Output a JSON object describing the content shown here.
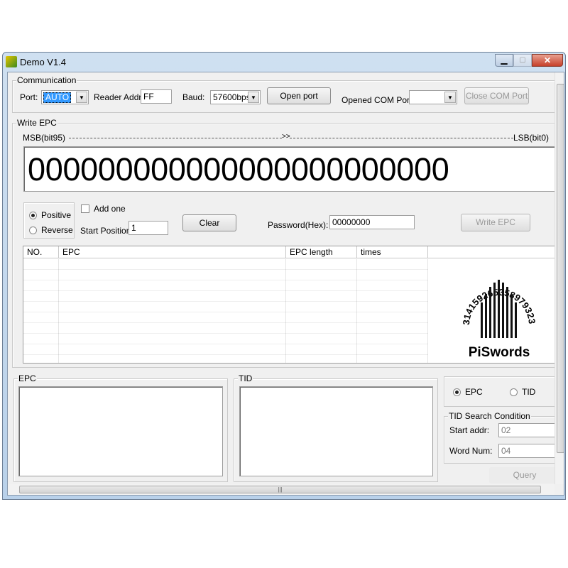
{
  "window": {
    "title": "Demo V1.4"
  },
  "communication": {
    "label": "Communication",
    "port_label": "Port:",
    "port_value": "AUTO",
    "reader_addr_label": "Reader Addr:",
    "reader_addr_value": "FF",
    "baud_label": "Baud:",
    "baud_value": "57600bps",
    "open_port": "Open port",
    "opened_com_label": "Opened COM Port:",
    "opened_com_value": "",
    "close_com": "Close COM Port"
  },
  "write_epc": {
    "label": "Write EPC",
    "msb": "MSB(bit95)",
    "arrow": ">>",
    "lsb": "LSB(bit0)",
    "epc_digits": "000000000000000000000000",
    "positive": "Positive",
    "reverse": "Reverse",
    "add_one": "Add one",
    "start_position_label": "Start Position:",
    "start_position_value": "1",
    "clear": "Clear",
    "password_label": "Password(Hex):",
    "password_value": "00000000",
    "write_epc_button": "Write EPC"
  },
  "table": {
    "columns": [
      "NO.",
      "EPC",
      "EPC length",
      "times"
    ],
    "rows": []
  },
  "logo": {
    "text": "PiSwords",
    "digits": "3141592653589793238462"
  },
  "epc_box": {
    "label": "EPC"
  },
  "tid_box": {
    "label": "TID"
  },
  "query": {
    "epc": "EPC",
    "tid": "TID",
    "selected": "EPC",
    "condition_label": "TID Search Condition",
    "start_addr_label": "Start addr:",
    "start_addr_value": "02",
    "word_num_label": "Word Num:",
    "word_num_value": "04",
    "query_button": "Query"
  }
}
